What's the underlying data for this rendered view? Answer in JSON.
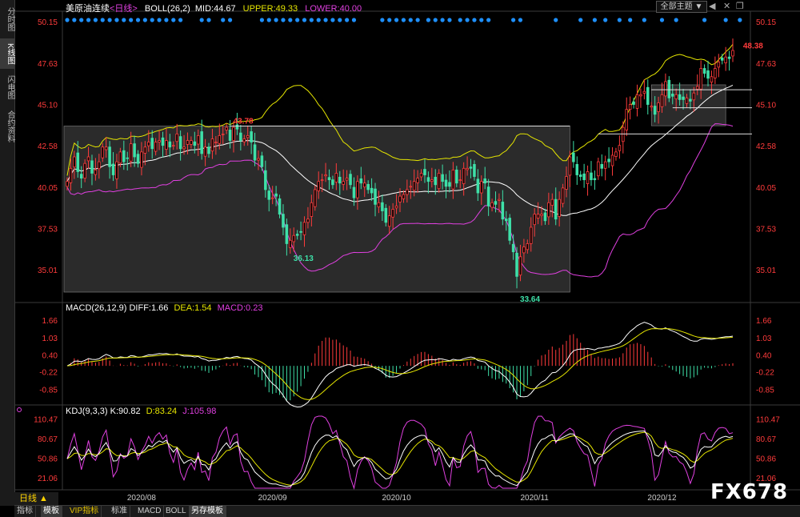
{
  "header": {
    "title": "美原油连续",
    "period": "<日线>",
    "indicator": "BOLL(26,2)",
    "mid": "MID:44.67",
    "upper": "UPPER:49.33",
    "lower": "LOWER:40.00",
    "theme_selector": "全部主题",
    "theme_arrow": "▼"
  },
  "left_tabs": [
    "分时图",
    "K线图",
    "闪电图",
    "合约资料"
  ],
  "bottom_tabs": [
    "指标",
    "模板",
    "VIP指标",
    "标准",
    "MACD",
    "BOLL",
    "另存模板"
  ],
  "period_badge": "日线 ▲",
  "watermark": "FX678",
  "macd_header": {
    "name": "MACD(26,12,9)",
    "diff": "DIFF:1.66",
    "dea": "DEA:1.54",
    "macd": "MACD:0.23"
  },
  "kdj_header": {
    "name": "KDJ(9,3,3)",
    "k": "K:90.82",
    "d": "D:83.24",
    "j": "J:105.98"
  },
  "colors": {
    "up": "#ff3b3b",
    "down": "#3ee0a8",
    "upper_band": "#e6e600",
    "mid_band": "#ffffff",
    "lower_band": "#e040e0",
    "macd_diff": "#ffffff",
    "macd_dea": "#e6e600",
    "kdj_k": "#ffffff",
    "kdj_d": "#e6e600",
    "kdj_j": "#e040e0",
    "marker": "#1e90ff"
  },
  "chart_data": {
    "type": "candlestick",
    "price_ticks": [
      "50.15",
      "47.63",
      "45.10",
      "42.58",
      "40.05",
      "37.53",
      "35.01"
    ],
    "price_tick_values": [
      50.15,
      47.63,
      45.1,
      42.58,
      40.05,
      37.53,
      35.01
    ],
    "ylim": [
      33.2,
      50.6
    ],
    "annotations": [
      {
        "text": "43.78",
        "value": 43.78,
        "index": 46
      },
      {
        "text": "36.13",
        "value": 36.13,
        "index": 63
      },
      {
        "text": "33.64",
        "value": 33.64,
        "index": 127
      },
      {
        "text": "48.38",
        "value": 48.38,
        "index": 190
      }
    ],
    "date_ticks": [
      {
        "label": "2020/08",
        "index": 21
      },
      {
        "label": "2020/09",
        "index": 58
      },
      {
        "label": "2020/10",
        "index": 93
      },
      {
        "label": "2020/11",
        "index": 132
      },
      {
        "label": "2020/12",
        "index": 168
      }
    ],
    "closes": [
      40.4,
      41.2,
      41.9,
      41.0,
      40.6,
      41.5,
      41.9,
      40.9,
      41.1,
      41.6,
      42.5,
      42.5,
      41.3,
      40.8,
      41.6,
      42.2,
      41.6,
      41.8,
      42.7,
      41.9,
      41.5,
      42.2,
      42.5,
      42.8,
      42.4,
      42.8,
      42.9,
      42.6,
      42.9,
      42.5,
      42.6,
      43.3,
      42.4,
      42.5,
      42.9,
      42.9,
      42.6,
      43.2,
      42.1,
      42.5,
      42.1,
      43.0,
      42.8,
      43.2,
      43.3,
      43.7,
      42.9,
      43.7,
      43.6,
      42.9,
      43.0,
      43.2,
      42.8,
      41.7,
      41.8,
      41.3,
      39.9,
      39.3,
      39.4,
      39.5,
      38.4,
      37.6,
      36.6,
      36.8,
      37.1,
      37.1,
      37.3,
      37.9,
      38.1,
      39.1,
      39.9,
      40.4,
      40.5,
      40.8,
      40.5,
      40.2,
      40.9,
      40.3,
      40.4,
      40.6,
      40.2,
      39.4,
      40.4,
      40.3,
      40.3,
      39.9,
      39.7,
      39.0,
      39.1,
      38.6,
      37.9,
      38.3,
      38.7,
      38.9,
      39.5,
      39.6,
      39.9,
      40.1,
      40.4,
      40.6,
      40.9,
      40.8,
      40.4,
      40.5,
      40.2,
      40.9,
      40.4,
      40.1,
      40.1,
      41.1,
      40.3,
      40.5,
      41.2,
      41.2,
      41.2,
      40.7,
      39.7,
      40.4,
      40.3,
      38.9,
      39.1,
      39.0,
      39.3,
      38.1,
      38.0,
      36.8,
      36.1,
      34.6,
      35.8,
      36.4,
      36.6,
      37.6,
      38.4,
      38.4,
      38.4,
      38.0,
      39.1,
      39.3,
      38.1,
      39.3,
      40.0,
      40.7,
      41.9,
      41.6,
      40.8,
      40.7,
      40.5,
      41.0,
      40.5,
      40.5,
      41.6,
      41.2,
      41.6,
      41.6,
      42.0,
      42.2,
      42.6,
      43.7,
      44.8,
      45.1,
      45.1,
      45.7,
      45.7,
      45.9,
      45.1,
      45.0,
      44.5,
      45.2,
      45.7,
      46.5,
      45.5,
      45.6,
      45.7,
      45.4,
      45.4,
      45.5,
      45.3,
      45.8,
      46.2,
      47.3,
      47.0,
      46.7,
      46.8,
      47.3,
      47.7,
      47.8,
      48.0,
      47.9,
      48.4
    ]
  }
}
